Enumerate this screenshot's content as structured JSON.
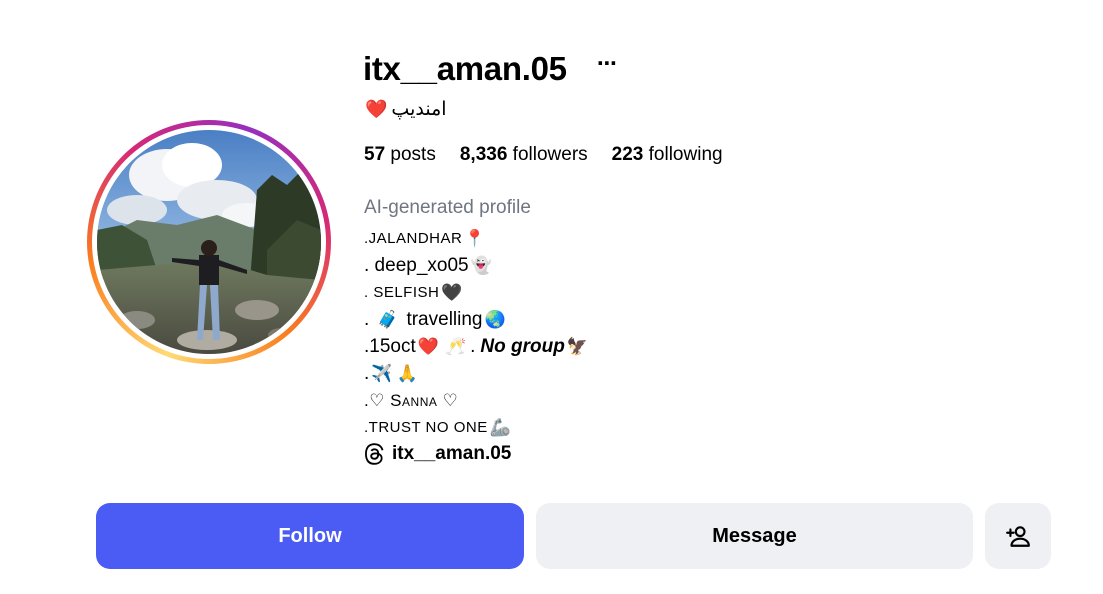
{
  "profile": {
    "username": "itx__aman.05",
    "more_icon_glyph": "⋯",
    "full_name": "امنديپ",
    "full_name_emoji": "❤️",
    "stats": {
      "posts_count": "57",
      "posts_label": "posts",
      "followers_count": "8,336",
      "followers_label": "followers",
      "following_count": "223",
      "following_label": "following"
    },
    "ai_label": "AI-generated profile",
    "bio": {
      "line1_text": ".JALANDHAR",
      "line1_emoji": "📍",
      "line2_text": ". deep_xo05",
      "line2_emoji": "👻",
      "line3_text": ". SELFISH",
      "line3_emoji": "🖤",
      "line4_text_a": ".",
      "line4_emoji_a": "🧳",
      "line4_text_b": "travelling",
      "line4_emoji_b": "🌏",
      "line5_text_a": ".15oct",
      "line5_emoji_a": "❤️",
      "line5_emoji_b": "🥂",
      "line5_text_b": ".",
      "line5_text_bold": "No group",
      "line5_emoji_c": "🦅",
      "line6_text": ".",
      "line6_emoji_a": "✈️",
      "line6_emoji_b": "🙏",
      "line7_text": ".♡ Sanna ♡",
      "line8_text": ".TRUST NO ONE",
      "line8_emoji": "🦾"
    },
    "threads_handle": "itx__aman.05"
  },
  "actions": {
    "follow_label": "Follow",
    "message_label": "Message",
    "add_user_glyph": "+"
  },
  "colors": {
    "follow_bg": "#4a5cf4",
    "secondary_bg": "#eff0f3",
    "muted_text": "#6e7681",
    "heart": "#e8264a"
  },
  "icons": {
    "more": "more-horizontal-icon",
    "threads": "threads-icon",
    "add_user": "add-user-icon"
  }
}
